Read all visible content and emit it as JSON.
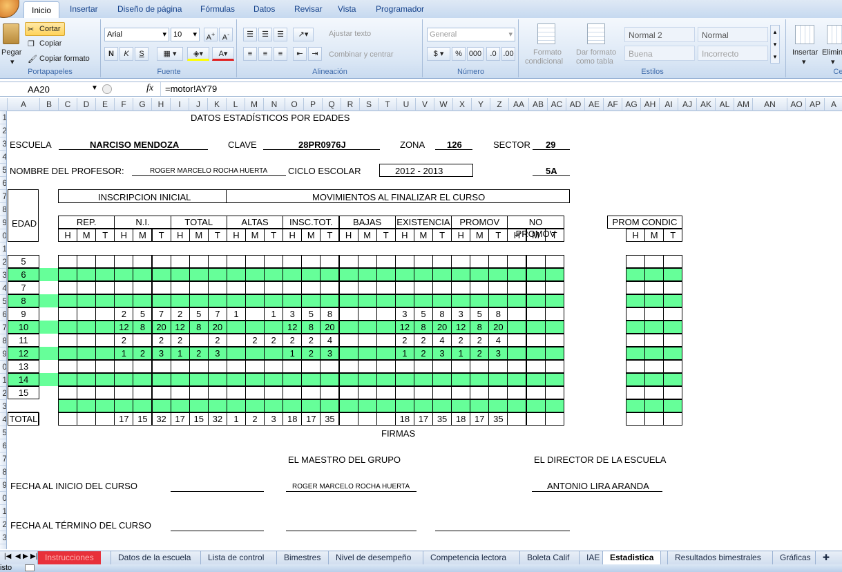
{
  "ribbon": {
    "tabs": [
      "Inicio",
      "Insertar",
      "Diseño de página",
      "Fórmulas",
      "Datos",
      "Revisar",
      "Vista",
      "Programador"
    ],
    "groups": [
      "Portapapeles",
      "Fuente",
      "Alineación",
      "Número",
      "Estilos",
      "Celd"
    ],
    "clipboard": {
      "paste": "Pegar",
      "cut": "Cortar",
      "copy": "Copiar",
      "format_painter": "Copiar formato"
    },
    "font": {
      "name": "Arial",
      "size": "10"
    },
    "alignment": {
      "wrap": "Ajustar texto",
      "merge": "Combinar y centrar"
    },
    "number": {
      "format": "General"
    },
    "styles": {
      "cond1": "Formato",
      "cond2": "condicional",
      "table1": "Dar formato",
      "table2": "como tabla",
      "s1": "Normal 2",
      "s2": "Normal",
      "s3": "Buena",
      "s4": "Incorrecto"
    },
    "cells": {
      "insert": "Insertar",
      "delete": "Elimin"
    }
  },
  "formula_bar": {
    "cell_ref": "AA20",
    "formula": "=motor!AY79"
  },
  "columns": [
    "A",
    "B",
    "C",
    "D",
    "E",
    "F",
    "G",
    "H",
    "I",
    "J",
    "K",
    "L",
    "M",
    "N",
    "O",
    "P",
    "Q",
    "R",
    "S",
    "T",
    "U",
    "V",
    "W",
    "X",
    "Y",
    "Z",
    "AA",
    "AB",
    "AC",
    "AD",
    "AE",
    "AF",
    "AG",
    "AH",
    "AI",
    "AJ",
    "AK",
    "AL",
    "AM",
    "AN",
    "AO",
    "AP",
    "A"
  ],
  "rows": [
    "1",
    "2",
    "3",
    "4",
    "5",
    "6",
    "7",
    "8",
    "9",
    "0",
    "1",
    "2",
    "3",
    "4",
    "5",
    "6",
    "7",
    "8",
    "9",
    "0",
    "1",
    "2",
    "3",
    "4",
    "5",
    "6",
    "7",
    "8",
    "9",
    "0",
    "1",
    "2",
    "3"
  ],
  "sheet": {
    "title": "DATOS ESTADÍSTICOS POR EDADES",
    "school_label": "ESCUELA",
    "school": "NARCISO MENDOZA",
    "key_label": "CLAVE",
    "key": "28PR0976J",
    "zone_label": "ZONA",
    "zone": "126",
    "sector_label": "SECTOR",
    "sector": "29",
    "teacher_label": "NOMBRE DEL PROFESOR:",
    "teacher": "ROGER MARCELO ROCHA HUERTA",
    "cycle_label": "CICLO ESCOLAR",
    "cycle": "2012   -   2013",
    "group": "5A",
    "header_initial": "INSCRIPCION INICIAL",
    "header_moves": "MOVIMIENTOS AL FINALIZAR EL CURSO",
    "age_label": "EDAD",
    "groups": [
      "REP.",
      "N.I.",
      "TOTAL",
      "ALTAS",
      "INSC.TOT.",
      "BAJAS",
      "EXISTENCIA",
      "PROMOV",
      "NO PROMOV"
    ],
    "prom_label": "PROM CONDIC",
    "subcols": [
      "H",
      "M",
      "T"
    ],
    "ages": [
      "5",
      "6",
      "7",
      "8",
      "9",
      "10",
      "11",
      "12",
      "13",
      "14",
      "15"
    ],
    "data": [
      [],
      [],
      [],
      [],
      [
        "",
        "",
        "",
        "2",
        "5",
        "7",
        "2",
        "5",
        "7",
        "1",
        "",
        "1",
        "3",
        "5",
        "8",
        "",
        "",
        "",
        "3",
        "5",
        "8",
        "3",
        "5",
        "8",
        "",
        "",
        ""
      ],
      [
        "",
        "",
        "",
        "12",
        "8",
        "20",
        "12",
        "8",
        "20",
        "",
        "",
        "",
        "12",
        "8",
        "20",
        "",
        "",
        "",
        "12",
        "8",
        "20",
        "12",
        "8",
        "20",
        "",
        "",
        ""
      ],
      [
        "",
        "",
        "",
        "2",
        "",
        "2",
        "2",
        "",
        "2",
        "",
        "2",
        "2",
        "2",
        "2",
        "4",
        "",
        "",
        "",
        "2",
        "2",
        "4",
        "2",
        "2",
        "4",
        "",
        "",
        ""
      ],
      [
        "",
        "",
        "",
        "1",
        "2",
        "3",
        "1",
        "2",
        "3",
        "",
        "",
        "",
        "1",
        "2",
        "3",
        "",
        "",
        "",
        "1",
        "2",
        "3",
        "1",
        "2",
        "3",
        "",
        "",
        ""
      ],
      [],
      [],
      []
    ],
    "total_label": "TOTAL",
    "totals": [
      "",
      "",
      "",
      "17",
      "15",
      "32",
      "17",
      "15",
      "32",
      "1",
      "2",
      "3",
      "18",
      "17",
      "35",
      "",
      "",
      "",
      "18",
      "17",
      "35",
      "18",
      "17",
      "35",
      "",
      "",
      ""
    ],
    "signatures": "FIRMAS",
    "teacher_sign_label": "EL MAESTRO DEL GRUPO",
    "director_sign_label": "EL DIRECTOR DE LA ESCUELA",
    "start_date_label": "FECHA AL INICIO DEL CURSO",
    "teacher_sign": "ROGER MARCELO ROCHA HUERTA",
    "director_sign": "ANTONIO LIRA ARANDA",
    "end_date_label": "FECHA AL TÉRMINO DEL CURSO"
  },
  "sheet_tabs": [
    "Instrucciones",
    "Datos de la escuela",
    "Lista de control",
    "Bimestres",
    "Nivel de desempeño",
    "Competencia lectora",
    "Boleta Calif",
    "IAE",
    "Estadistica",
    "Resultados bimestrales",
    "Gráficas"
  ],
  "active_sheet": "Estadistica",
  "status": {
    "text": "isto"
  },
  "colors": {
    "green": "#66ff99",
    "instrucciones_tab": "#e8303a"
  }
}
